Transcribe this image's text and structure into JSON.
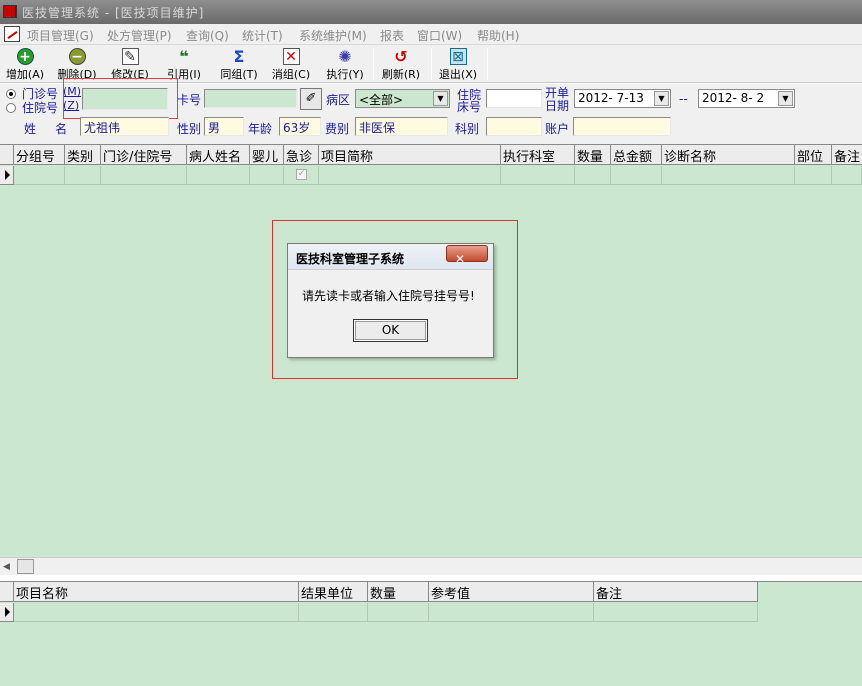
{
  "window": {
    "title": "医技管理系统 - [医技项目维护]"
  },
  "menu": [
    {
      "label": "项目管理(G)",
      "name": "menu-project"
    },
    {
      "label": "处方管理(P)",
      "name": "menu-prescription"
    },
    {
      "label": "查询(Q)",
      "name": "menu-query"
    },
    {
      "label": "统计(T)",
      "name": "menu-statistics"
    },
    {
      "label": "系统维护(M)",
      "name": "menu-system"
    },
    {
      "label": "报表",
      "name": "menu-report"
    },
    {
      "label": "窗口(W)",
      "name": "menu-window"
    },
    {
      "label": "帮助(H)",
      "name": "menu-help"
    }
  ],
  "toolbar": [
    {
      "label": "增加(A)",
      "icon": "add-icon"
    },
    {
      "label": "删除(D)",
      "icon": "delete-icon"
    },
    {
      "label": "修改(E)",
      "icon": "edit-icon"
    },
    {
      "label": "引用(I)",
      "icon": "quote-icon"
    },
    {
      "label": "同组(T)",
      "icon": "sum-icon"
    },
    {
      "label": "消组(C)",
      "icon": "remove-group-icon"
    },
    {
      "label": "执行(Y)",
      "icon": "execute-icon"
    },
    {
      "label": "刷新(R)",
      "icon": "refresh-icon"
    },
    {
      "label": "退出(X)",
      "icon": "exit-icon"
    }
  ],
  "form": {
    "radio_outpatient": "门诊号",
    "radio_outpatient_key": "(M)",
    "radio_inpatient": "住院号",
    "radio_inpatient_key": "(Z)",
    "card_label": "卡号",
    "ward_label": "病区",
    "ward_value": "<全部>",
    "bed_label_1": "住院",
    "bed_label_2": "床号",
    "date_label_1": "开单",
    "date_label_2": "日期",
    "date_from": "2012- 7-13",
    "date_sep": "--",
    "date_to": "2012- 8- 2",
    "name_label": "姓     名",
    "name_value": "尤祖伟",
    "gender_label": "性别",
    "gender_value": "男",
    "age_label": "年龄",
    "age_value": "63岁",
    "fee_label": "费别",
    "fee_value": "非医保",
    "dept_label": "科别",
    "account_label": "账户"
  },
  "grid": {
    "columns": [
      "分组号",
      "类别",
      "门诊/住院号",
      "病人姓名",
      "婴儿",
      "急诊",
      "项目简称",
      "执行科室",
      "数量",
      "总金额",
      "诊断名称",
      "部位",
      "备注"
    ],
    "emergency_check": "✓"
  },
  "grid2": {
    "columns": [
      "项目名称",
      "结果单位",
      "数量",
      "参考值",
      "备注"
    ]
  },
  "dialog": {
    "title": "医技科室管理子系统",
    "close": "✕",
    "message": "请先读卡或者输入住院号挂号号!",
    "ok": "OK"
  }
}
